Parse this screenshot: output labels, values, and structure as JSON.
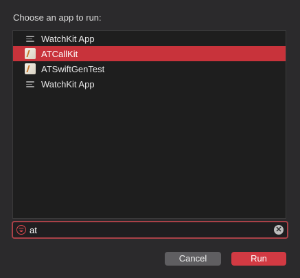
{
  "dialog": {
    "prompt": "Choose an app to run:"
  },
  "apps": [
    {
      "label": "WatchKit App",
      "icon": "watchkit-app-icon",
      "selected": false
    },
    {
      "label": "ATCallKit",
      "icon": "app-icon",
      "selected": true
    },
    {
      "label": "ATSwiftGenTest",
      "icon": "app-icon",
      "selected": false
    },
    {
      "label": "WatchKit App",
      "icon": "watchkit-app-icon",
      "selected": false
    }
  ],
  "search": {
    "value": "at",
    "placeholder": ""
  },
  "buttons": {
    "cancel": "Cancel",
    "run": "Run"
  },
  "colors": {
    "accent": "#d23a43",
    "selection": "#c8333b",
    "background": "#2b2a2c"
  }
}
